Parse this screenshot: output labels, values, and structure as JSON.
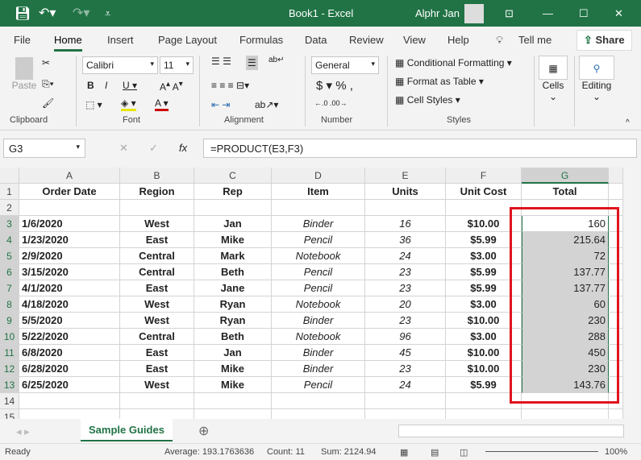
{
  "title_bar": {
    "document": "Book1  -  Excel",
    "user": "Alphr Jan"
  },
  "menu_tabs": [
    "File",
    "Home",
    "Insert",
    "Page Layout",
    "Formulas",
    "Data",
    "Review",
    "View",
    "Help",
    "Tell me"
  ],
  "share_label": "Share",
  "ribbon": {
    "paste": "Paste",
    "font_name": "Calibri",
    "font_size": "11",
    "number_format": "General",
    "conditional_formatting": "Conditional Formatting",
    "format_as_table": "Format as Table",
    "cell_styles": "Cell Styles",
    "cells": "Cells",
    "editing": "Editing",
    "groups": [
      "Clipboard",
      "Font",
      "Alignment",
      "Number",
      "Styles"
    ]
  },
  "formula_bar": {
    "name_box": "G3",
    "formula": "=PRODUCT(E3,F3)",
    "fx": "fx"
  },
  "columns": [
    "A",
    "B",
    "C",
    "D",
    "E",
    "F",
    "G"
  ],
  "headers": [
    "Order Date",
    "Region",
    "Rep",
    "Item",
    "Units",
    "Unit Cost",
    "Total"
  ],
  "rows": [
    [
      "1/6/2020",
      "West",
      "Jan",
      "Binder",
      "16",
      "$10.00",
      "160"
    ],
    [
      "1/23/2020",
      "East",
      "Mike",
      "Pencil",
      "36",
      "$5.99",
      "215.64"
    ],
    [
      "2/9/2020",
      "Central",
      "Mark",
      "Notebook",
      "24",
      "$3.00",
      "72"
    ],
    [
      "3/15/2020",
      "Central",
      "Beth",
      "Pencil",
      "23",
      "$5.99",
      "137.77"
    ],
    [
      "4/1/2020",
      "East",
      "Jane",
      "Pencil",
      "23",
      "$5.99",
      "137.77"
    ],
    [
      "4/18/2020",
      "West",
      "Ryan",
      "Notebook",
      "20",
      "$3.00",
      "60"
    ],
    [
      "5/5/2020",
      "West",
      "Ryan",
      "Binder",
      "23",
      "$10.00",
      "230"
    ],
    [
      "5/22/2020",
      "Central",
      "Beth",
      "Notebook",
      "96",
      "$3.00",
      "288"
    ],
    [
      "6/8/2020",
      "East",
      "Jan",
      "Binder",
      "45",
      "$10.00",
      "450"
    ],
    [
      "6/28/2020",
      "East",
      "Mike",
      "Binder",
      "23",
      "$10.00",
      "230"
    ],
    [
      "6/25/2020",
      "West",
      "Mike",
      "Pencil",
      "24",
      "$5.99",
      "143.76"
    ]
  ],
  "row_numbers": [
    "1",
    "2",
    "3",
    "4",
    "5",
    "6",
    "7",
    "8",
    "9",
    "10",
    "11",
    "12",
    "13",
    "14",
    "15"
  ],
  "sheet_tab": "Sample Guides",
  "status": {
    "ready": "Ready",
    "average": "Average: 193.1763636",
    "count": "Count: 11",
    "sum": "Sum: 2124.94",
    "zoom": "100%"
  },
  "colors": {
    "excel_green": "#217346",
    "highlight": "#e0141e"
  }
}
